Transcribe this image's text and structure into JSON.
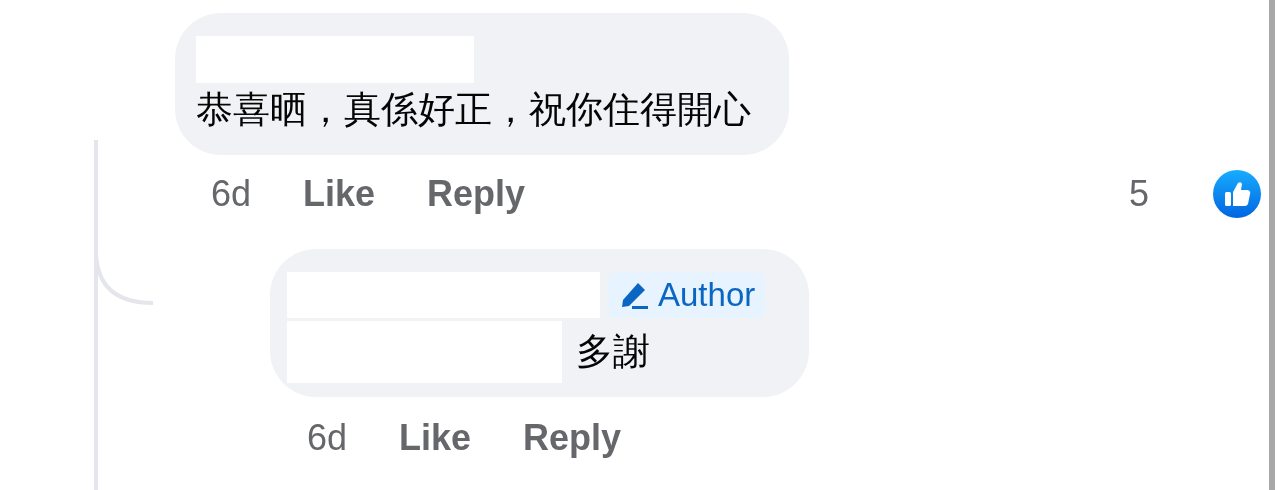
{
  "comments": [
    {
      "text": "恭喜晒，真係好正，祝你住得開心",
      "time": "6d",
      "actions": [
        "Like",
        "Reply"
      ],
      "reaction_count": "5",
      "replies": [
        {
          "badge": "Author",
          "text": "多謝",
          "time": "6d",
          "actions": [
            "Like",
            "Reply"
          ]
        }
      ]
    }
  ]
}
